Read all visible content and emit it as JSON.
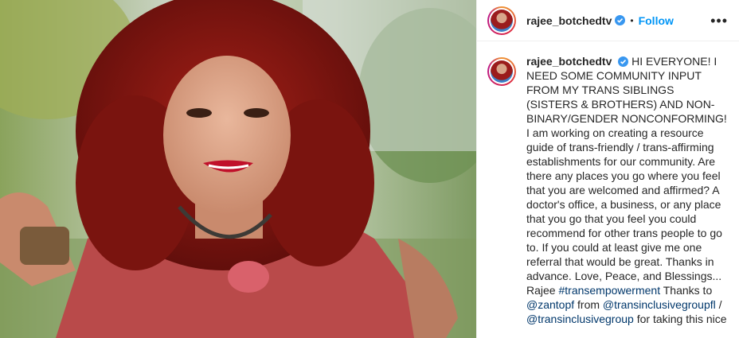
{
  "post": {
    "username": "rajee_botchedtv",
    "verified": true,
    "separator": "•",
    "follow_label": "Follow",
    "more_label": "•••",
    "verified_icon": "verified-badge-icon",
    "accent_color": "#0095f6"
  },
  "caption": {
    "username": "rajee_botchedtv",
    "part1": "HI EVERYONE! I NEED SOME COMMUNITY INPUT FROM MY TRANS SIBLINGS (SISTERS & BROTHERS) AND NON-BINARY/GENDER NONCONFORMING! I am working on creating a resource guide of trans-friendly / trans-affirming establishments for our community. Are there any places you go where you feel that you are welcomed and affirmed? A doctor's office, a business, or any place that you go that you feel you could recommend for other trans people to go to. If you could at least give me one referral that would be great. Thanks in advance. Love, Peace, and Blessings... Rajee",
    "hashtag": "#transempowerment",
    "part2": "Thanks to",
    "mention1": "@zantopf",
    "part3": "from",
    "mention2": "@transinclusivegroupfl",
    "part4": "/",
    "mention3": "@transinclusivegroup",
    "part5": "for taking this nice"
  }
}
